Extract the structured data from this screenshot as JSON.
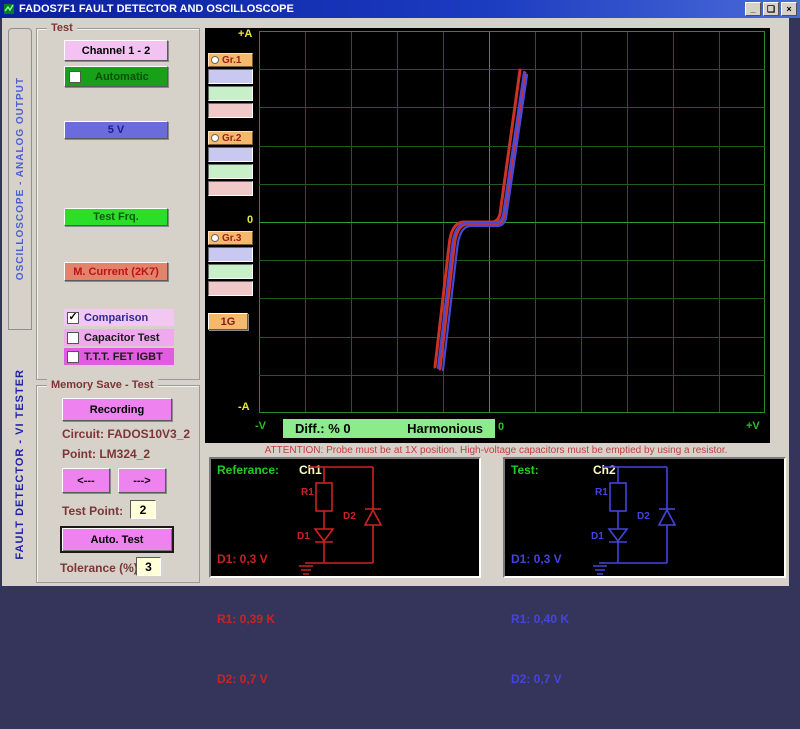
{
  "window": {
    "title": "FADOS7F1  FAULT DETECTOR AND OSCILLOSCOPE",
    "buttons": {
      "minimize": "_",
      "restore": "❏",
      "close": "×"
    }
  },
  "tabs": {
    "oscilloscope": "OSCILLOSCOPE  -  ANALOG OUTPUT",
    "fault_detector": "FAULT DETECTOR - VI TESTER"
  },
  "test_group": {
    "title": "Test",
    "channel_button": "Channel 1 - 2",
    "automatic_label": "Automatic",
    "voltage_button": "5 V",
    "test_frq_button": "Test Frq.",
    "current_button": "M. Current (2K7)",
    "checkboxes": [
      {
        "label": "Comparison",
        "checked": "✓"
      },
      {
        "label": "Capacitor Test",
        "checked": ""
      },
      {
        "label": "T.T.T. FET  IGBT",
        "checked": ""
      }
    ]
  },
  "memory_group": {
    "title": "Memory Save - Test",
    "recording_button": "Recording",
    "circuit_label": "Circuit: FADOS10V3_2",
    "point_label": "Point:  LM324_2",
    "prev_button": "<---",
    "next_button": "--->",
    "test_point_label": "Test Point:",
    "test_point_value": "2",
    "auto_test_button": "Auto. Test",
    "tolerance_label": "Tolerance (%)",
    "tolerance_value": "3"
  },
  "scope": {
    "labels": {
      "plus_a": "+A",
      "zero_left": "0",
      "minus_a": "-A",
      "minus_v": "-V",
      "zero_bottom": "0",
      "plus_v": "+V"
    },
    "groups": [
      {
        "label": "Gr.1"
      },
      {
        "label": "Gr.2"
      },
      {
        "label": "Gr.3"
      }
    ],
    "gain_button": "1G",
    "diff_text": "Diff.:  % 0",
    "harmonious_text": "Harmonious",
    "grid": {
      "cols": 11,
      "rows": 10,
      "line_color": "#1d5c1d",
      "center_color": "#2f9e2f",
      "border_color": "#2a8a2a"
    },
    "trace": {
      "red": "#cc3322",
      "blue": "#4848dc",
      "red_paths": [
        "M181,338 L195,217 Q197,194 208,193 L236,193 Q243,193 245,185 L266,42",
        "M176,336 L190,215 Q192,192 204,191 L233,191 Q239,191 241,183 L261,39"
      ],
      "blue_paths": [
        "M179,337 L193,216 Q195,193 207,192 L235,192 Q242,192 244,184 L265,41",
        "M184,339 L198,219 Q200,196 211,195 L238,195 Q245,195 247,187 L268,44"
      ]
    }
  },
  "attention": "ATTENTION:  Probe must be at 1X position. High-voltage capacitors must be emptied by using a resistor.",
  "reference_panel": {
    "title": "Referance:",
    "channel": "Ch1",
    "color": "#cc2222",
    "values": {
      "d1": "D1: 0,3 V",
      "r1": "R1: 0,39 K",
      "d2": "D2: 0,7 V"
    },
    "component_labels": {
      "r1": "R1",
      "d1": "D1",
      "d2": "D2"
    }
  },
  "test_panel": {
    "title": "Test:",
    "channel": "Ch2",
    "color": "#4444dd",
    "values": {
      "d1": "D1: 0,3 V",
      "r1": "R1: 0,40 K",
      "d2": "D2: 0,7 V"
    },
    "component_labels": {
      "r1": "R1",
      "d1": "D1",
      "d2": "D2"
    }
  }
}
